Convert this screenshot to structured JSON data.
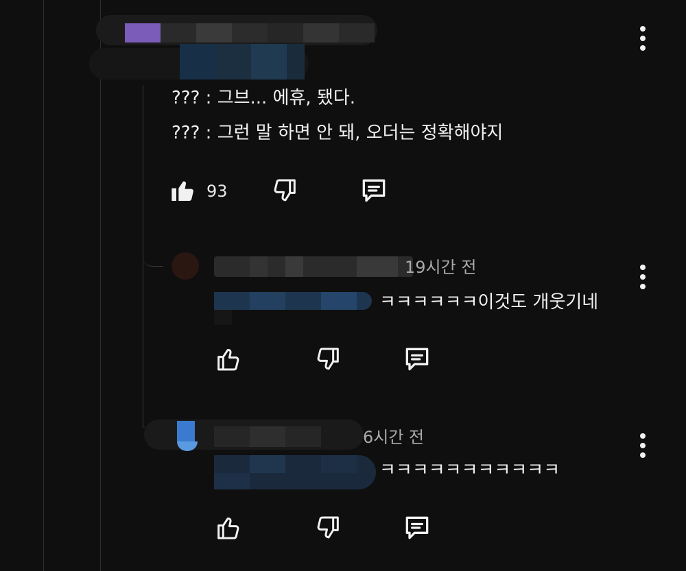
{
  "colors": {
    "background": "#0f0f0f",
    "text": "#f1f1f1",
    "meta": "#aaaaaa",
    "line": "#2f2f2f"
  },
  "comment": {
    "lines": [
      "??? : 그브... 에휴, 됐다.",
      "??? : 그런 말 하면 안 돼, 오더는 정확해야지"
    ],
    "like_count": "93",
    "icons": [
      "like-filled-icon",
      "dislike-icon",
      "reply-icon",
      "more-vert-icon"
    ]
  },
  "replies": [
    {
      "time": "19시간 전",
      "text": "ㅋㅋㅋㅋㅋㅋ이것도 개웃기네",
      "icons": [
        "like-icon",
        "dislike-icon",
        "reply-icon",
        "more-vert-icon"
      ]
    },
    {
      "time": "6시간 전",
      "text": "ㅋㅋㅋㅋㅋㅋㅋㅋㅋㅋㅋ",
      "icons": [
        "like-icon",
        "dislike-icon",
        "reply-icon",
        "more-vert-icon"
      ]
    }
  ]
}
